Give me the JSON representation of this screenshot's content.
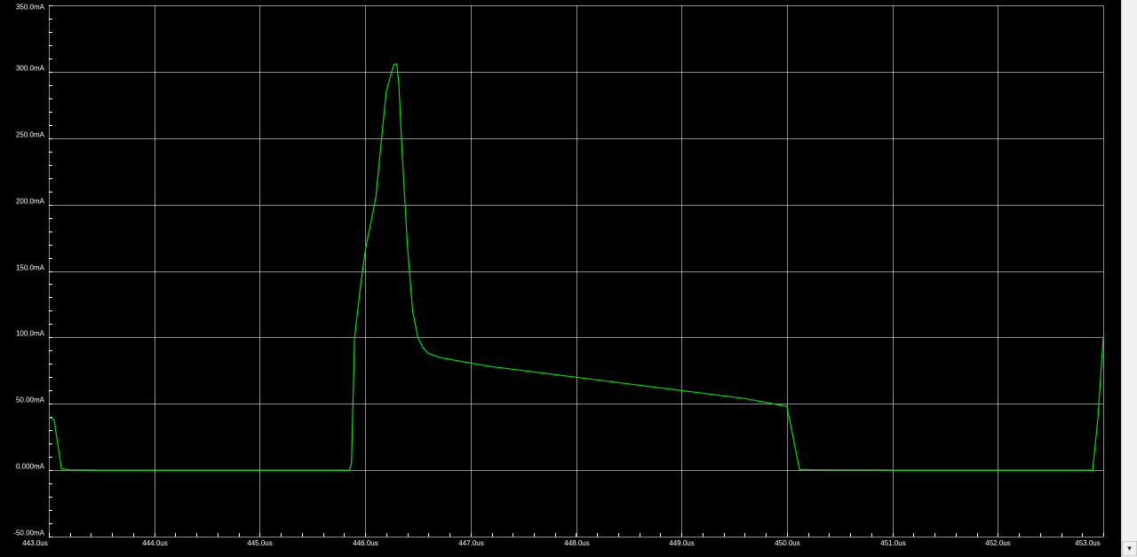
{
  "chart_data": {
    "type": "line",
    "title": "",
    "xlabel": "",
    "ylabel": "",
    "xlim": [
      443.0,
      453.0
    ],
    "ylim": [
      -50.0,
      350.0
    ],
    "grid": true,
    "x_tick_labels": [
      "443.0us",
      "444.0us",
      "445.0us",
      "446.0us",
      "447.0us",
      "448.0us",
      "449.0us",
      "450.0us",
      "451.0us",
      "452.0us",
      "453.0us"
    ],
    "x_ticks": [
      443,
      444,
      445,
      446,
      447,
      448,
      449,
      450,
      451,
      452,
      453
    ],
    "y_tick_labels": [
      "350.0mA",
      "300.0mA",
      "250.0mA",
      "200.0mA",
      "150.0mA",
      "100.0mA",
      "50.00mA",
      "0.000mA",
      "-50.00mA"
    ],
    "y_ticks": [
      350,
      300,
      250,
      200,
      150,
      100,
      50,
      0,
      -50
    ],
    "series": [
      {
        "color": "#00e000",
        "x": [
          443.0,
          443.05,
          443.12,
          443.2,
          443.5,
          443.9,
          444.5,
          445.5,
          445.85,
          445.87,
          445.9,
          445.95,
          446.0,
          446.1,
          446.2,
          446.27,
          446.3,
          446.32,
          446.35,
          446.4,
          446.45,
          446.5,
          446.55,
          446.6,
          446.7,
          446.9,
          447.2,
          447.6,
          448.0,
          448.4,
          448.8,
          449.2,
          449.6,
          450.0,
          450.12,
          450.3,
          450.9,
          451.0,
          452.0,
          452.9,
          452.95,
          453.0
        ],
        "y": [
          40,
          38,
          1,
          0.3,
          0,
          0,
          0,
          0,
          0,
          5,
          100,
          135,
          165,
          205,
          285,
          305,
          306,
          290,
          240,
          170,
          120,
          100,
          92,
          88,
          85,
          82,
          78,
          74,
          70,
          66,
          62,
          58,
          54,
          48,
          0.5,
          0.3,
          0.2,
          0,
          0,
          0,
          40,
          100
        ]
      }
    ]
  },
  "ui": {
    "scroll_down_glyph": "▾"
  }
}
